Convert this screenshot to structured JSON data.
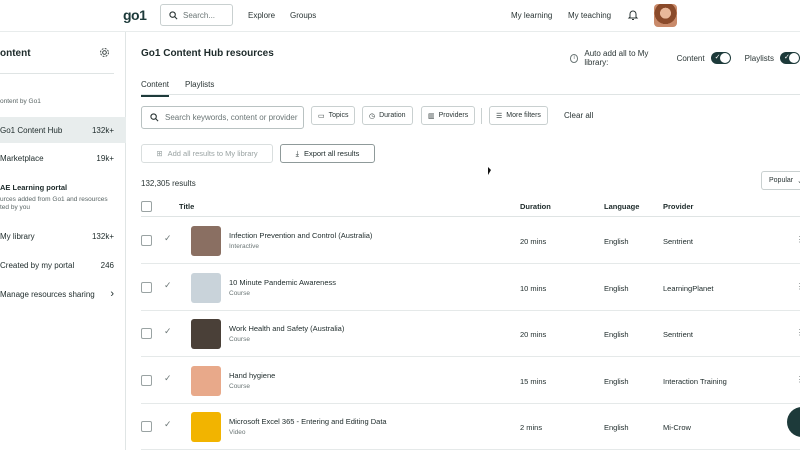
{
  "topnav": {
    "logo": "go1",
    "search_placeholder": "Search...",
    "links": [
      "Explore",
      "Groups",
      "My learning",
      "My teaching"
    ]
  },
  "sidebar": {
    "title": "ontent",
    "subtitle": "ontent by Go1",
    "items": [
      {
        "label": "Go1 Content Hub",
        "count": "132k+"
      },
      {
        "label": "Marketplace",
        "count": "19k+"
      }
    ],
    "portal_heading": "AE Learning portal",
    "portal_desc_1": "urces added from Go1 and resources",
    "portal_desc_2": "ted by you",
    "portal_items": [
      {
        "label": "My library",
        "count": "132k+"
      },
      {
        "label": "Created by my portal",
        "count": "246"
      },
      {
        "label": "Manage resources sharing",
        "count": "›"
      }
    ]
  },
  "main": {
    "title": "Go1 Content Hub resources",
    "autoadd_label": "Auto add all to My library:",
    "autoadd_content": "Content",
    "autoadd_playlists": "Playlists",
    "tabs": [
      "Content",
      "Playlists"
    ],
    "search_placeholder": "Search keywords, content or provider",
    "filters": [
      "Topics",
      "Duration",
      "Providers",
      "More filters"
    ],
    "clear_all": "Clear all",
    "add_all": "Add all results to My library",
    "export_all": "Export all results",
    "results_count": "132,305 results",
    "sort": "Popular",
    "columns": [
      "Title",
      "Duration",
      "Language",
      "Provider"
    ],
    "rows": [
      {
        "title": "Infection Prevention and Control (Australia)",
        "type": "Interactive",
        "duration": "20 mins",
        "language": "English",
        "provider": "Sentrient",
        "thumb": "#8a6f62"
      },
      {
        "title": "10 Minute Pandemic Awareness",
        "type": "Course",
        "duration": "10 mins",
        "language": "English",
        "provider": "LearningPlanet",
        "thumb": "#c9d3da"
      },
      {
        "title": "Work Health and Safety (Australia)",
        "type": "Course",
        "duration": "20 mins",
        "language": "English",
        "provider": "Sentrient",
        "thumb": "#4a4038"
      },
      {
        "title": "Hand hygiene",
        "type": "Course",
        "duration": "15 mins",
        "language": "English",
        "provider": "Interaction Training",
        "thumb": "#e8a98a"
      },
      {
        "title": "Microsoft Excel 365 - Entering and Editing Data",
        "type": "Video",
        "duration": "2 mins",
        "language": "English",
        "provider": "Mi-Crow",
        "thumb": "#f2b400"
      }
    ]
  }
}
